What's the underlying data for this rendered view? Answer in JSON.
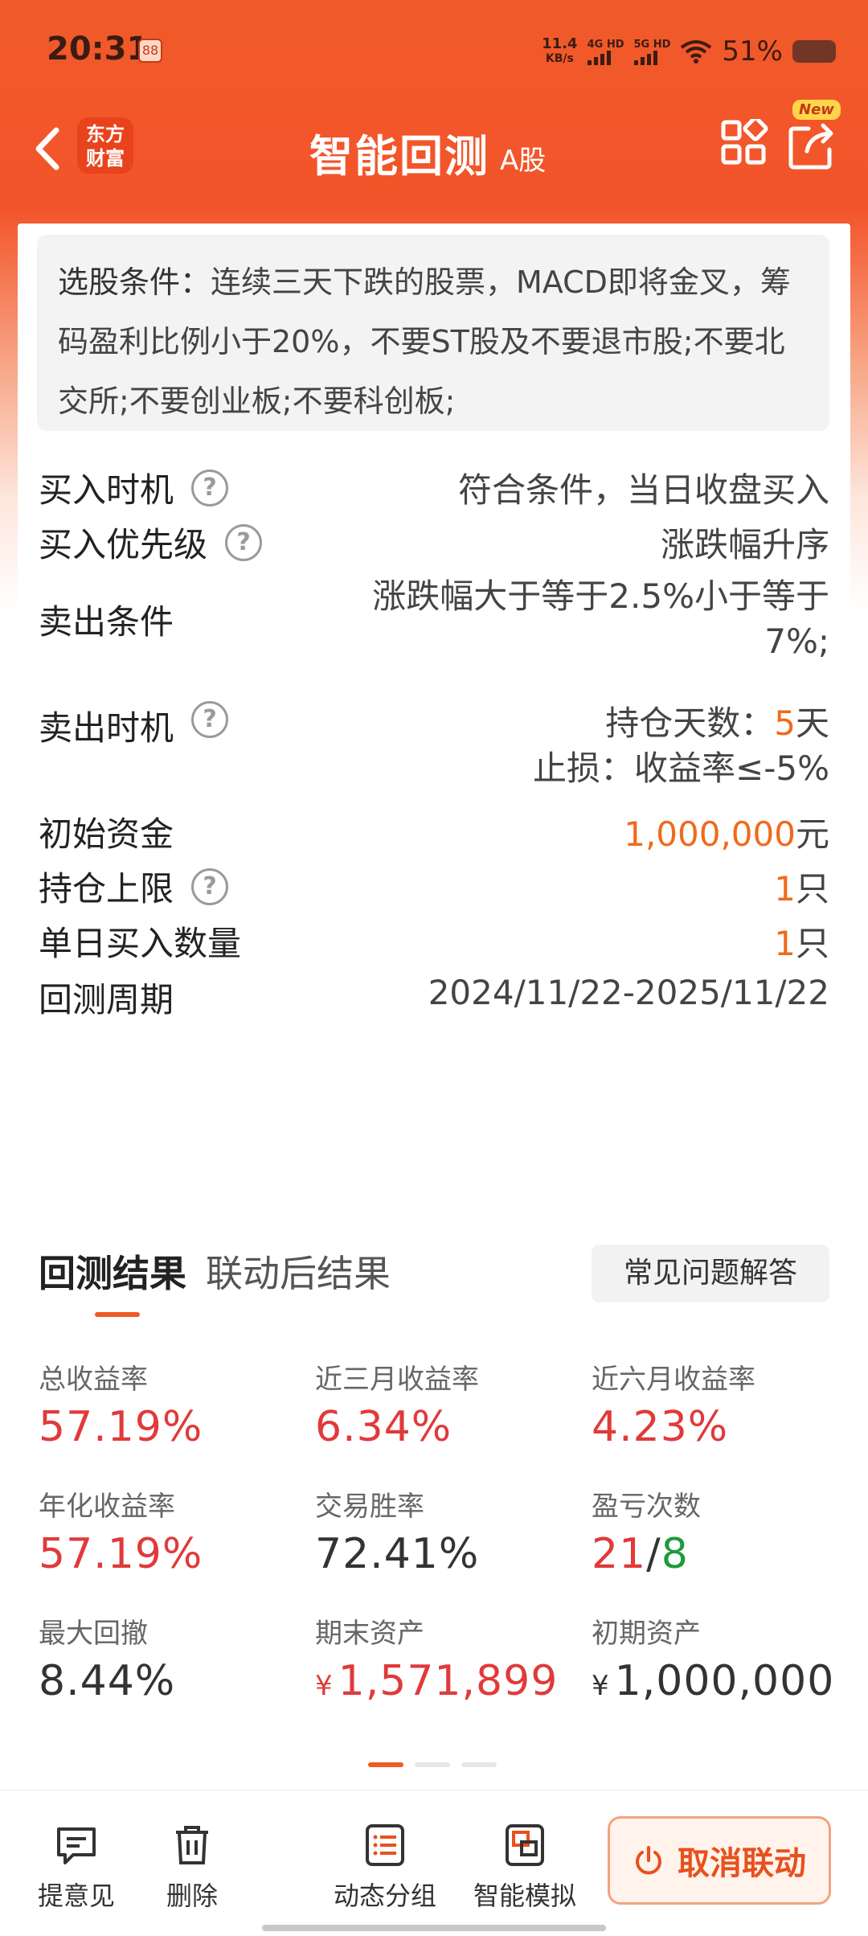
{
  "status_bar": {
    "time": "20:31",
    "app_icon_text": "88",
    "net_speed_value": "11.4",
    "net_speed_unit": "KB/s",
    "sim1": "4G HD",
    "sim2": "5G HD",
    "battery_text": "51%"
  },
  "nav": {
    "logo_line1": "东方",
    "logo_line2": "财富",
    "title": "智能回测",
    "subtitle": "A股",
    "new_badge": "New"
  },
  "conditions": {
    "label": "选股条件：",
    "text": "连续三天下跌的股票，MACD即将金叉，筹码盈利比例小于20%，不要ST股及不要退市股;不要北交所;不要创业板;不要科创板;"
  },
  "rows": {
    "buy_timing": {
      "label": "买入时机",
      "value": "符合条件，当日收盘买入"
    },
    "buy_priority": {
      "label": "买入优先级",
      "value": "涨跌幅升序"
    },
    "sell_condition": {
      "label": "卖出条件",
      "value_line1": "涨跌幅大于等于2.5%小于等于",
      "value_line2": "7%;"
    },
    "sell_timing": {
      "label": "卖出时机",
      "hold_prefix": "持仓天数：",
      "hold_days": "5",
      "hold_unit": "天",
      "stop_loss": "止损：收益率≤-5%"
    },
    "initial_capital": {
      "label": "初始资金",
      "amount": "1,000,000",
      "unit": "元"
    },
    "position_limit": {
      "label": "持仓上限",
      "amount": "1",
      "unit": "只"
    },
    "daily_buy_count": {
      "label": "单日买入数量",
      "amount": "1",
      "unit": "只"
    },
    "backtest_period": {
      "label": "回测周期",
      "value": "2024/11/22-2025/11/22"
    }
  },
  "tabs": {
    "active": "回测结果",
    "other": "联动后结果",
    "faq": "常见问题解答"
  },
  "metrics": {
    "total_return": {
      "label": "总收益率",
      "value": "57.19%"
    },
    "return_3m": {
      "label": "近三月收益率",
      "value": "6.34%"
    },
    "return_6m": {
      "label": "近六月收益率",
      "value": "4.23%"
    },
    "annual_return": {
      "label": "年化收益率",
      "value": "57.19%"
    },
    "win_rate": {
      "label": "交易胜率",
      "value": "72.41%"
    },
    "win_loss": {
      "label": "盈亏次数",
      "wins": "21",
      "sep": "/",
      "losses": "8"
    },
    "max_drawdown": {
      "label": "最大回撤",
      "value": "8.44%"
    },
    "final_assets": {
      "label": "期末资产",
      "yen": "¥",
      "value": "1,571,899"
    },
    "initial_assets": {
      "label": "初期资产",
      "yen": "¥",
      "value": "1,000,000"
    }
  },
  "bottom_bar": {
    "feedback": "提意见",
    "delete": "删除",
    "dynamic_group": "动态分组",
    "smart_sim": "智能模拟",
    "cancel_link": "取消联动"
  },
  "colors": {
    "accent": "#f05a24",
    "positive": "#e03a3a",
    "negative": "#1e9a3a",
    "highlight": "#f06a1c"
  }
}
